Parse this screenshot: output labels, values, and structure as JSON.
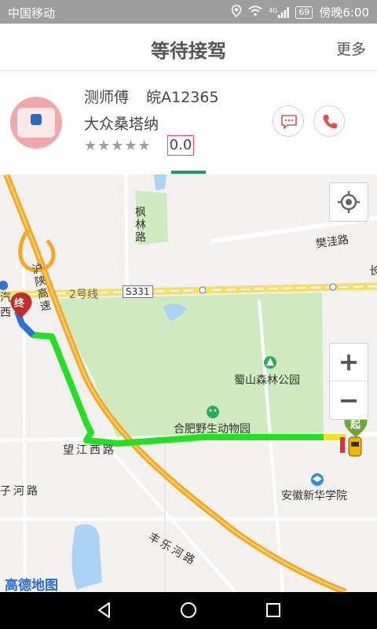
{
  "status_bar": {
    "carrier": "中国移动",
    "network": "4G",
    "battery": "69",
    "time": "傍晚6:00"
  },
  "header": {
    "title": "等待接驾",
    "more_label": "更多"
  },
  "driver": {
    "name": "测师傅",
    "plate": "皖A12365",
    "car_model": "大众桑塔纳",
    "stars": "★★★★★",
    "rating": "0.0"
  },
  "map": {
    "labels": {
      "fenglin_road": "枫林路",
      "fanwa_road": "樊洼路",
      "hushan_expressway": "沪陕高速",
      "line2": "2号线",
      "s331": "S331",
      "shushan_park": "蜀山森林公园",
      "zoo": "合肥野生动物园",
      "wangjiang_road": "望江西路",
      "zihe_road": "子河路",
      "anhui_xinhua": "安徽新华学院",
      "fengle_road": "丰乐河路",
      "start_marker": "起",
      "end_marker": "终",
      "chang": "长",
      "qi_left": "汽",
      "xi_left": "西"
    },
    "logo": "高德地图",
    "zoom_in_label": "+",
    "zoom_out_label": "−",
    "colors": {
      "route_green": "#22e022",
      "route_yellow": "#f5e21a",
      "route_blue": "#2f6fd8",
      "expressway": "#f7a823",
      "park": "#cdeac0"
    }
  }
}
